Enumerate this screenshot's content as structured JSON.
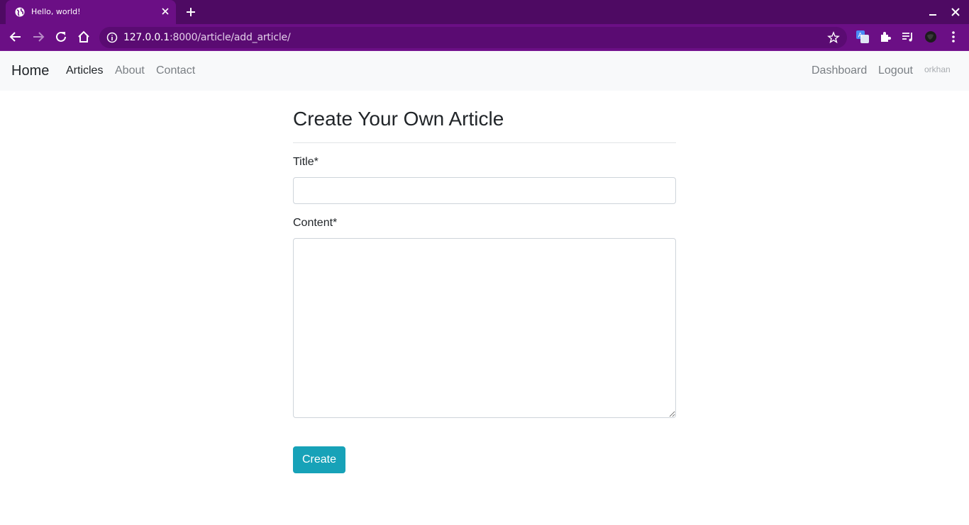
{
  "browser": {
    "tab_title": "Hello, world!",
    "url_host": "127.0.0.1",
    "url_rest": ":8000/article/add_article/"
  },
  "navbar": {
    "brand": "Home",
    "links": [
      "Articles",
      "About",
      "Contact"
    ],
    "right_links": [
      "Dashboard",
      "Logout"
    ],
    "username": "orkhan"
  },
  "form": {
    "heading": "Create Your Own Article",
    "title_label": "Title*",
    "title_value": "",
    "content_label": "Content*",
    "content_value": "",
    "submit_label": "Create"
  },
  "colors": {
    "browser_frame": "#4e0a63",
    "browser_toolbar": "#6b0f85",
    "navbar_bg": "#f8f9fa",
    "button_info": "#17a2b8"
  },
  "icons": [
    "globe-icon",
    "close-icon",
    "plus-icon",
    "minimize-icon",
    "back-icon",
    "forward-icon",
    "reload-icon",
    "home-icon",
    "info-icon",
    "star-icon",
    "translate-icon",
    "puzzle-icon",
    "media-icon",
    "profile-icon",
    "menu-icon"
  ]
}
